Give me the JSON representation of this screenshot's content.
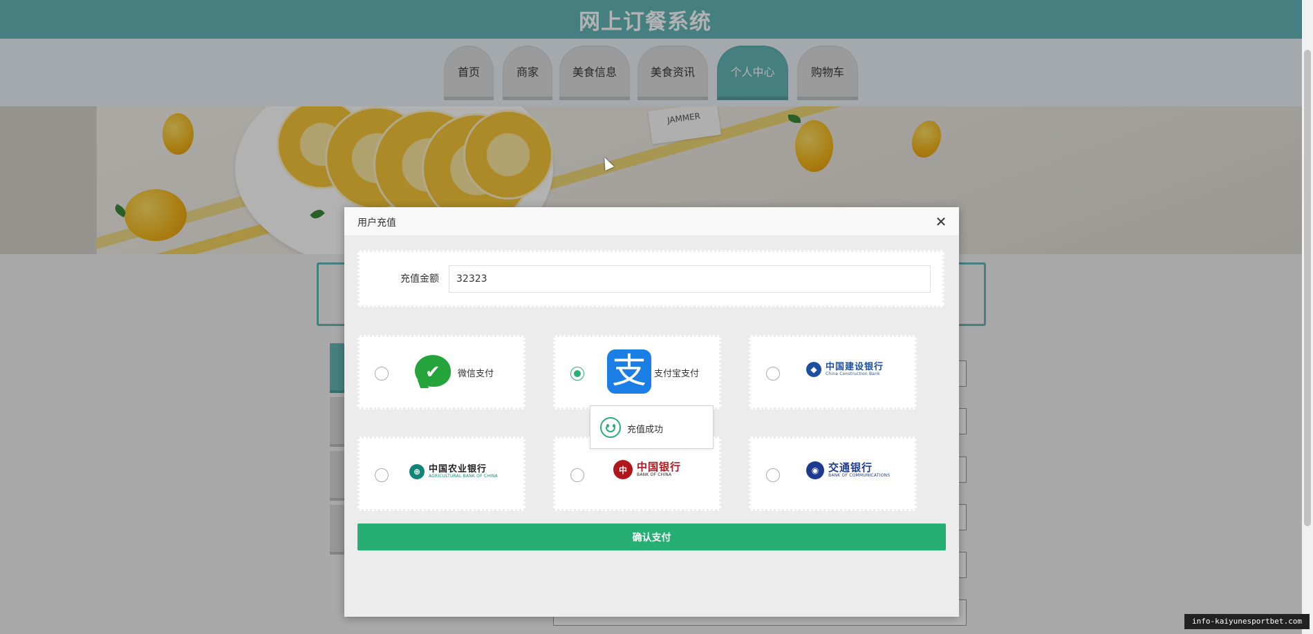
{
  "header": {
    "site_title": "网上订餐系统"
  },
  "nav": {
    "tabs": [
      {
        "label": "首页",
        "active": false
      },
      {
        "label": "商家",
        "active": false
      },
      {
        "label": "美食信息",
        "active": false
      },
      {
        "label": "美食资讯",
        "active": false
      },
      {
        "label": "个人中心",
        "active": true
      },
      {
        "label": "购物车",
        "active": false
      }
    ]
  },
  "banner": {
    "card_text": "JAMMER"
  },
  "modal": {
    "title": "用户充值",
    "close_icon": "close-icon",
    "amount_label": "充值金额",
    "amount_value": "32323",
    "payments": [
      {
        "id": "wechat",
        "label": "微信支付",
        "checked": false,
        "icon": "wechat-pay-logo"
      },
      {
        "id": "alipay",
        "label": "支付宝支付",
        "checked": true,
        "icon": "alipay-logo"
      },
      {
        "id": "ccb",
        "label": "中国建设银行",
        "en": "China Construction Bank",
        "checked": false,
        "icon": "ccb-logo",
        "color": "#1d4f9e"
      },
      {
        "id": "abc",
        "label": "中国农业银行",
        "en": "AGRICULTURAL BANK OF CHINA",
        "checked": false,
        "icon": "abc-logo",
        "color": "#138577"
      },
      {
        "id": "boc",
        "label": "中国银行",
        "en": "BANK OF CHINA",
        "checked": false,
        "icon": "boc-logo",
        "color": "#b1161c"
      },
      {
        "id": "bocom",
        "label": "交通银行",
        "en": "BANK OF COMMUNICATIONS",
        "checked": false,
        "icon": "bocom-logo",
        "color": "#1c3a8f"
      }
    ],
    "confirm_label": "确认支付"
  },
  "toast": {
    "message": "充值成功",
    "icon": "smile-icon"
  },
  "watermark": {
    "text": "info-kaiyunesportbet.com"
  },
  "colors": {
    "brand": "#63b6b8",
    "confirm": "#27ae72"
  }
}
